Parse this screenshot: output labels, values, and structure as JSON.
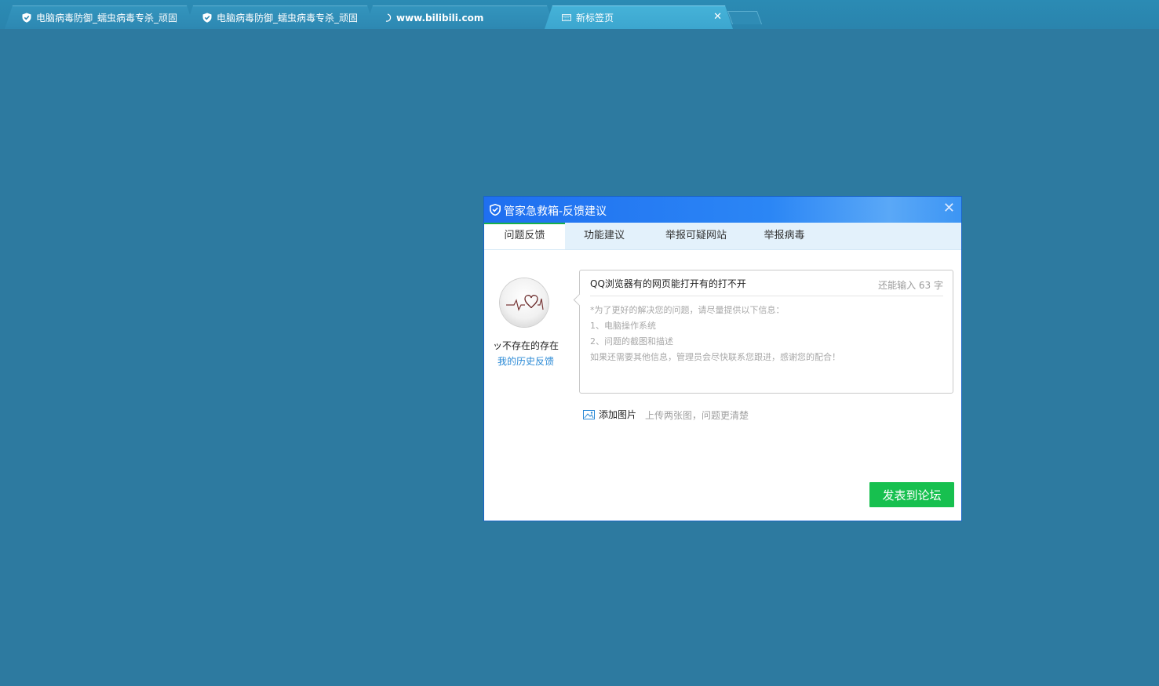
{
  "browser": {
    "tabs": [
      {
        "title": "电脑病毒防御_蠕虫病毒专杀_顽固",
        "icon": "shield-icon",
        "active": false
      },
      {
        "title": "电脑病毒防御_蠕虫病毒专杀_顽固",
        "icon": "shield-icon",
        "active": false
      },
      {
        "title": "www.bilibili.com",
        "icon": "loading-icon",
        "active": false
      },
      {
        "title": "新标签页",
        "icon": "newtab-page-icon",
        "active": true
      }
    ],
    "close_glyph": "✕",
    "accent": "#2d7aa0"
  },
  "dialog": {
    "title": "管家急救箱-反馈建议",
    "close_glyph": "✕",
    "tabs": [
      {
        "label": "问题反馈",
        "active": true
      },
      {
        "label": "功能建议",
        "active": false
      },
      {
        "label": "举报可疑网站",
        "active": false
      },
      {
        "label": "举报病毒",
        "active": false
      }
    ],
    "user": {
      "name": "ッ不存在的存在",
      "history_link": "我的历史反馈"
    },
    "form": {
      "subject": "QQ浏览器有的网页能打开有的打不开",
      "remaining": "还能输入 63 字",
      "placeholder_lines": [
        "*为了更好的解决您的问题，请尽量提供以下信息：",
        "1、电脑操作系统",
        "2、问题的截图和描述",
        "如果还需要其他信息，管理员会尽快联系您跟进，感谢您的配合！"
      ],
      "add_image_label": "添加图片",
      "add_image_hint": "上传两张图，问题更清楚"
    },
    "submit_label": "发表到论坛",
    "colors": {
      "titlebar": "#2b86f5",
      "active_tab_indicator": "#18b04a",
      "submit": "#17c04f",
      "link": "#2b8ad6"
    }
  }
}
